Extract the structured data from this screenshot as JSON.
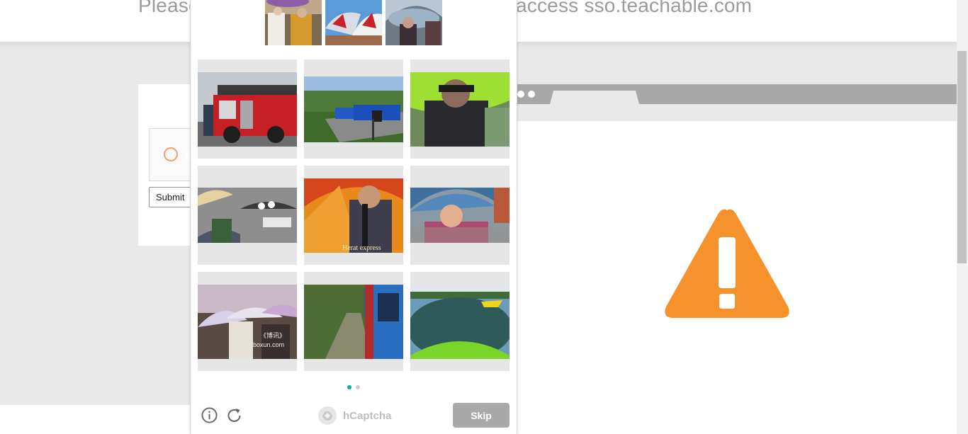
{
  "page": {
    "headline_before": "Please",
    "headline_after": "access sso.teachable.com",
    "submit_label": "Submit"
  },
  "captcha": {
    "examples": [
      "umbrella-example-1",
      "umbrella-example-2",
      "umbrella-example-3"
    ],
    "tiles": [
      {
        "name": "tile-fire-truck",
        "caption": ""
      },
      {
        "name": "tile-trucks-on-road",
        "caption": ""
      },
      {
        "name": "tile-person-green-umbrella",
        "caption": ""
      },
      {
        "name": "tile-crowd-umbrellas",
        "caption": ""
      },
      {
        "name": "tile-orange-umbrella",
        "caption": "Herat express"
      },
      {
        "name": "tile-blue-umbrella",
        "caption": ""
      },
      {
        "name": "tile-umbrellas-blossoms",
        "caption": "《博讯》 boxun.com"
      },
      {
        "name": "tile-train",
        "caption": ""
      },
      {
        "name": "tile-boat-water",
        "caption": ""
      }
    ],
    "page_indicator": {
      "current": 1,
      "total": 2
    },
    "brand": "hCaptcha",
    "skip_label": "Skip",
    "accent_color": "#00b3a6",
    "warning_color": "#f5922b"
  }
}
